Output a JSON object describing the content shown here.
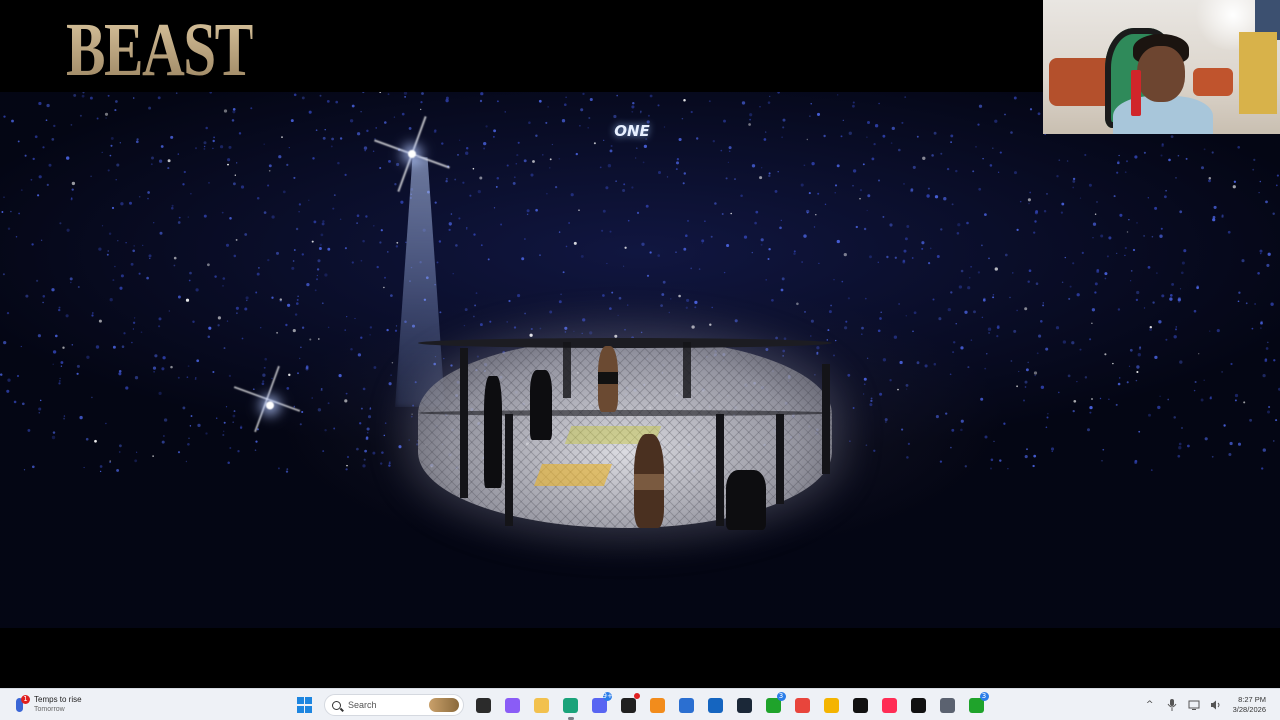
{
  "video": {
    "overlay_logo": "BEAST",
    "arena_sign": "ONE"
  },
  "taskbar": {
    "weather": {
      "title": "Temps to rise",
      "subtitle": "Tomorrow",
      "badge": "1",
      "icon": "thermometer-icon"
    },
    "search": {
      "placeholder": "Search"
    },
    "apps": [
      {
        "name": "file-explorer-dark-icon",
        "color": "#2b2b2b"
      },
      {
        "name": "copilot-icon",
        "color": "#8a5cf6"
      },
      {
        "name": "folder-icon",
        "color": "#f2c14e"
      },
      {
        "name": "edge-icon",
        "color": "#1aa37a",
        "active": true
      },
      {
        "name": "discord-icon",
        "color": "#5865f2",
        "badge": "9+"
      },
      {
        "name": "obs-icon",
        "color": "#202020",
        "dot": true
      },
      {
        "name": "vlc-icon",
        "color": "#f28c1c"
      },
      {
        "name": "store-icon",
        "color": "#2b6fd1"
      },
      {
        "name": "outlook-icon",
        "color": "#1565c0"
      },
      {
        "name": "steam-icon",
        "color": "#1b2838"
      },
      {
        "name": "xbox-icon",
        "color": "#1fa32b",
        "badge": "3"
      },
      {
        "name": "chrome-icon",
        "color": "#e8453c"
      },
      {
        "name": "rockstar-icon",
        "color": "#f4b400"
      },
      {
        "name": "full-screen-app-icon",
        "color": "#111111"
      },
      {
        "name": "tiktok-icon",
        "color": "#ff2d55"
      },
      {
        "name": "tiktok-live-icon",
        "color": "#111111"
      },
      {
        "name": "settings-icon",
        "color": "#5b6270"
      },
      {
        "name": "xbox-game-bar-icon",
        "color": "#1fa32b",
        "badge": "3"
      }
    ],
    "tray": {
      "chevron": "^",
      "time": "8:27 PM",
      "date": "3/28/2026"
    }
  }
}
